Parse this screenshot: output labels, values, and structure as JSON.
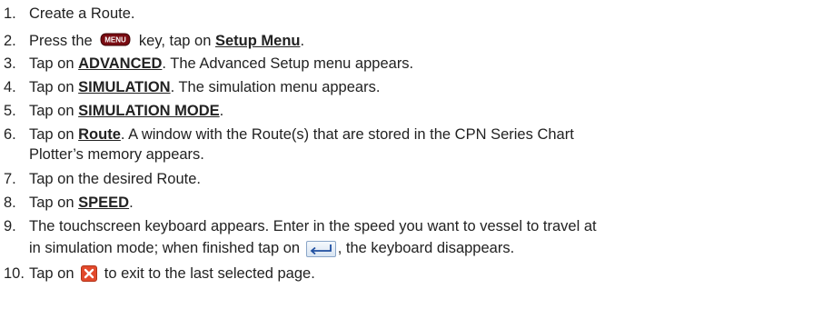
{
  "steps": [
    {
      "num": "1.",
      "text": "Create a Route."
    },
    {
      "num": "2.",
      "pre": "Press the",
      "icon": "menu-key-icon",
      "mid": "key, tap on",
      "kw": "Setup Menu",
      "post": "."
    },
    {
      "num": "3.",
      "pre": "Tap on",
      "kw": "ADVANCED",
      "post": ". The Advanced Setup menu appears."
    },
    {
      "num": "4.",
      "pre": "Tap on",
      "kw": "SIMULATION",
      "post": ". The simulation menu appears."
    },
    {
      "num": "5.",
      "pre": "Tap on",
      "kw": "SIMULATION MODE",
      "post": "."
    },
    {
      "num": "6.",
      "pre": "Tap on",
      "kw": "Route",
      "post": ". A window with the Route(s) that are stored in the CPN Series Chart",
      "cont": "Plotter’s memory appears."
    },
    {
      "num": "7.",
      "text": "Tap on the desired Route."
    },
    {
      "num": "8.",
      "pre": "Tap on",
      "kw": "SPEED",
      "post": "."
    },
    {
      "num": "9.",
      "text": "The touchscreen keyboard appears. Enter in the speed you want to vessel to travel at",
      "cont_pre": "in simulation mode; when finished tap on",
      "icon": "enter-key-icon",
      "cont_post": ", the keyboard disappears."
    },
    {
      "num": "10.",
      "pre": "Tap on",
      "icon": "close-icon",
      "post": "to exit to the last selected page."
    }
  ],
  "icons": {
    "menu_key_label": "MENU",
    "menu_key_color": "#7a0c12",
    "enter_key_color": "#1f4fa0",
    "close_color": "#e2492c"
  }
}
